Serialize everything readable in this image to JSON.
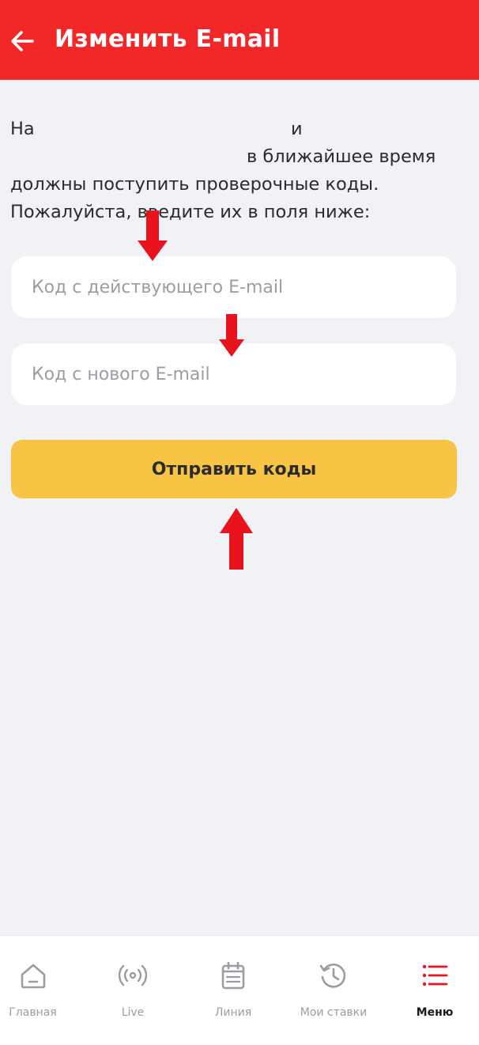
{
  "header": {
    "title": "Изменить E-mail",
    "back_icon": "arrow-left-icon"
  },
  "intro": {
    "line1_start": "На",
    "line1_end": "и",
    "line2": "в ближайшее время",
    "line3": "должны поступить проверочные коды.",
    "line4": "Пожалуйста, введите их в поля ниже:"
  },
  "form": {
    "current_code": {
      "placeholder": "Код с действующего E-mail",
      "value": ""
    },
    "new_code": {
      "placeholder": "Код с нового E-mail",
      "value": ""
    },
    "submit_label": "Отправить коды"
  },
  "bottom_nav": {
    "items": [
      {
        "label": "Главная",
        "icon": "home-icon",
        "active": false
      },
      {
        "label": "Live",
        "icon": "broadcast-icon",
        "active": false
      },
      {
        "label": "Линия",
        "icon": "calendar-icon",
        "active": false
      },
      {
        "label": "Мои ставки",
        "icon": "history-icon",
        "active": false
      },
      {
        "label": "Меню",
        "icon": "menu-list-icon",
        "active": true
      }
    ]
  },
  "colors": {
    "header": "#f22727",
    "background": "#f0f2f6",
    "button": "#f8c443",
    "annotation_arrow": "#e8131c",
    "nav_active_icon": "#e8131c",
    "nav_inactive": "#9a9da3"
  }
}
